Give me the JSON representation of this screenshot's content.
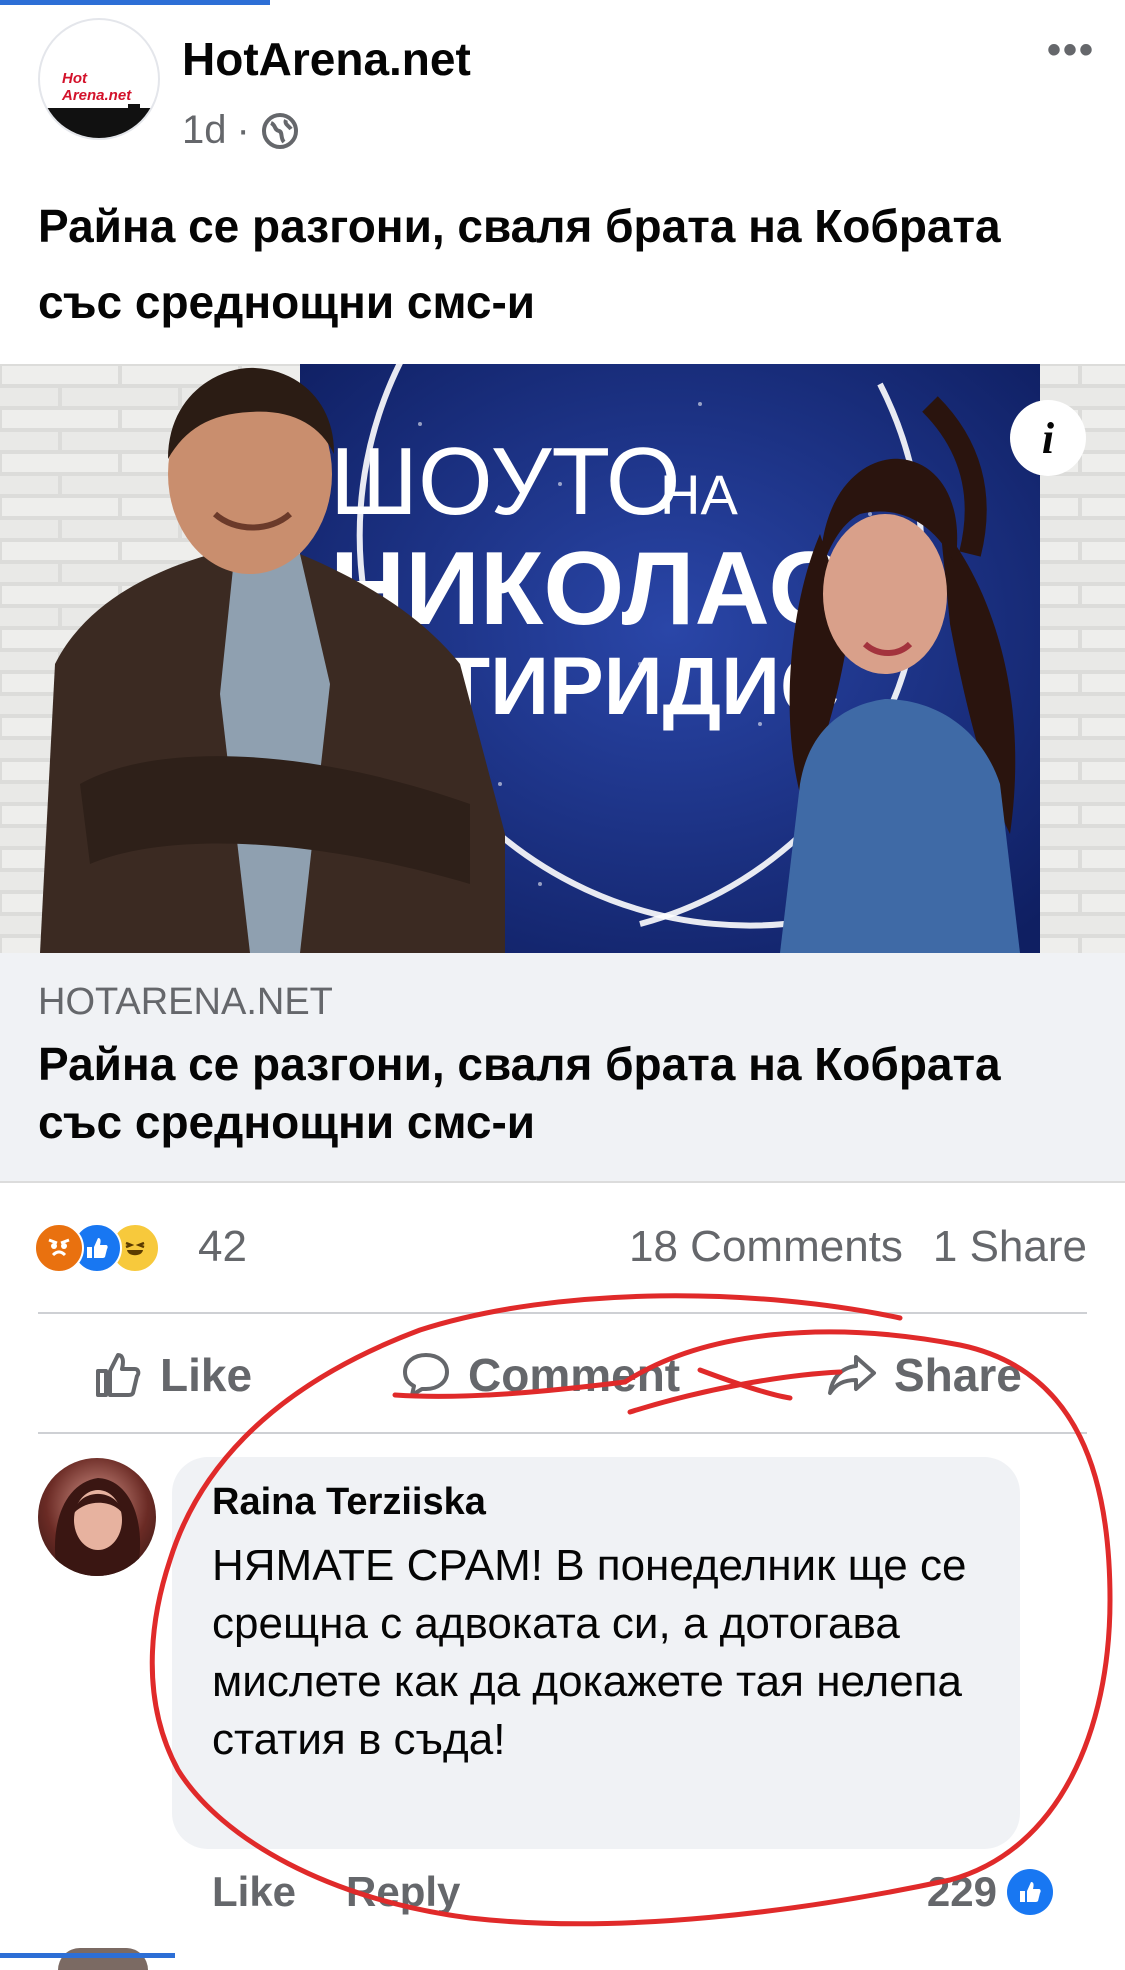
{
  "post": {
    "page_name": "HotArena.net",
    "avatar_logo": "Hot Arena.net",
    "time": "1d",
    "separator": "·",
    "privacy_icon": "globe-icon",
    "more_icon": "•••",
    "text": "Райна се разгони, сваля брата на Кобрата със среднощни смс-и"
  },
  "image": {
    "sign_line1": "ШОУТО",
    "sign_na": "НА",
    "sign_line2": "НИКОЛАО",
    "sign_line3": "ТИРИДИС",
    "info_icon": "i"
  },
  "link_preview": {
    "domain": "HOTARENA.NET",
    "title": "Райна се разгони, сваля брата на Кобрата със среднощни смс-и"
  },
  "stats": {
    "reaction_icons": [
      "angry-icon",
      "like-icon",
      "haha-icon"
    ],
    "reaction_count": "42",
    "comments": "18 Comments",
    "shares": "1 Share"
  },
  "actions": {
    "like": "Like",
    "comment": "Comment",
    "share": "Share"
  },
  "comment": {
    "author": "Raina Terziiska",
    "text": "НЯМАТЕ СРАМ! В понеделник ще се срещна с адвоката си, а дотогава мислете как да докажете тая нелепа статия в съда!",
    "like_label": "Like",
    "reply_label": "Reply",
    "likes": "229"
  },
  "colors": {
    "accent": "#1877f2",
    "secondary_text": "#65676b",
    "annotation": "#e02a2a",
    "bubble_bg": "#f0f2f5"
  }
}
